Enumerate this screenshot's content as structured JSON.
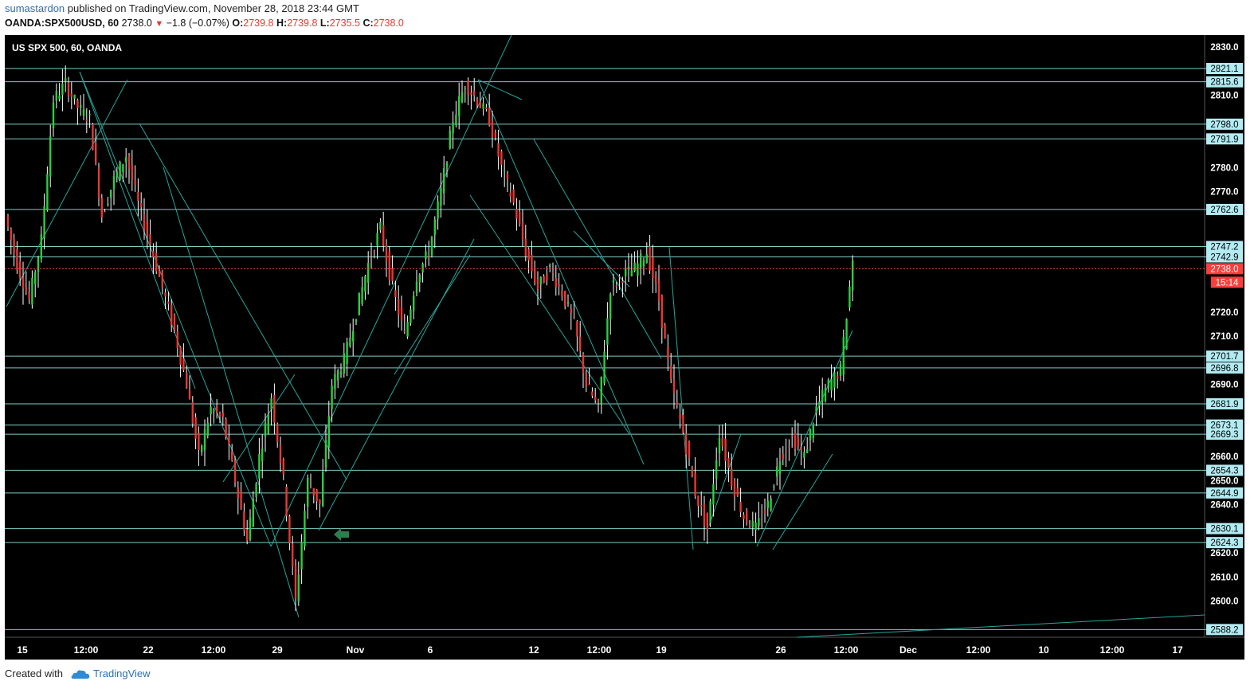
{
  "header": {
    "user": "sumastardon",
    "published": " published on TradingView.com, November 28, 2018 23:44 GMT",
    "symbol": "OANDA:SPX500USD, 60",
    "last": "2738.0",
    "change": "−1.8 (−0.07%)",
    "o_label": "O:",
    "o_val": "2739.8",
    "h_label": "H:",
    "h_val": "2739.8",
    "l_label": "L:",
    "l_val": "2735.5",
    "c_label": "C:",
    "c_val": "2738.0"
  },
  "footer": {
    "created": "Created with",
    "brand": "TradingView"
  },
  "colors": {
    "background": "#000000",
    "grid_line": "#80cbc4",
    "trend_line": "#26a69a",
    "price_line": "#ff3d3d",
    "candle_up": "#2ecc40",
    "candle_down": "#e53935",
    "candle_wick": "#ffffff",
    "arrow": "#2e7d4f"
  },
  "chart_data": {
    "type": "candlestick",
    "title": "US SPX 500, 60, OANDA",
    "ylim": [
      2585,
      2835
    ],
    "y_ticks": [
      2600,
      2610,
      2620,
      2640,
      2650,
      2660,
      2690,
      2710,
      2720,
      2770,
      2780,
      2810,
      2830
    ],
    "x_ticks": [
      "15",
      "12:00",
      "22",
      "12:00",
      "29",
      "Nov",
      "6",
      "12",
      "12:00",
      "19",
      "26",
      "12:00",
      "Dec",
      "12:00",
      "10",
      "12:00",
      "17"
    ],
    "horizontal_levels": [
      2821.1,
      2815.6,
      2798.0,
      2791.9,
      2762.6,
      2747.2,
      2742.9,
      2701.7,
      2696.8,
      2681.9,
      2673.1,
      2669.3,
      2654.3,
      2644.9,
      2630.1,
      2624.3,
      2588.2
    ],
    "current_price": 2738.0,
    "countdown": "15:14",
    "price_path": [
      [
        0,
        2760
      ],
      [
        2,
        2740
      ],
      [
        4,
        2725
      ],
      [
        6,
        2750
      ],
      [
        8,
        2808
      ],
      [
        10,
        2815
      ],
      [
        12,
        2805
      ],
      [
        14,
        2800
      ],
      [
        16,
        2760
      ],
      [
        18,
        2775
      ],
      [
        20,
        2785
      ],
      [
        22,
        2765
      ],
      [
        24,
        2748
      ],
      [
        26,
        2730
      ],
      [
        28,
        2712
      ],
      [
        30,
        2690
      ],
      [
        32,
        2660
      ],
      [
        34,
        2680
      ],
      [
        36,
        2675
      ],
      [
        38,
        2650
      ],
      [
        40,
        2625
      ],
      [
        42,
        2660
      ],
      [
        44,
        2685
      ],
      [
        46,
        2650
      ],
      [
        48,
        2600
      ],
      [
        50,
        2650
      ],
      [
        52,
        2640
      ],
      [
        54,
        2690
      ],
      [
        56,
        2700
      ],
      [
        58,
        2720
      ],
      [
        60,
        2740
      ],
      [
        62,
        2755
      ],
      [
        64,
        2730
      ],
      [
        66,
        2710
      ],
      [
        68,
        2735
      ],
      [
        70,
        2745
      ],
      [
        72,
        2770
      ],
      [
        74,
        2800
      ],
      [
        76,
        2815
      ],
      [
        78,
        2808
      ],
      [
        80,
        2800
      ],
      [
        82,
        2780
      ],
      [
        84,
        2765
      ],
      [
        86,
        2745
      ],
      [
        88,
        2730
      ],
      [
        90,
        2738
      ],
      [
        92,
        2728
      ],
      [
        94,
        2715
      ],
      [
        96,
        2690
      ],
      [
        98,
        2680
      ],
      [
        100,
        2730
      ],
      [
        102,
        2735
      ],
      [
        104,
        2738
      ],
      [
        106,
        2745
      ],
      [
        108,
        2725
      ],
      [
        110,
        2690
      ],
      [
        112,
        2670
      ],
      [
        114,
        2645
      ],
      [
        116,
        2630
      ],
      [
        118,
        2670
      ],
      [
        120,
        2650
      ],
      [
        122,
        2635
      ],
      [
        124,
        2630
      ],
      [
        126,
        2640
      ],
      [
        128,
        2660
      ],
      [
        130,
        2668
      ],
      [
        132,
        2660
      ],
      [
        134,
        2680
      ],
      [
        136,
        2690
      ],
      [
        138,
        2696
      ],
      [
        140,
        2742
      ]
    ]
  }
}
